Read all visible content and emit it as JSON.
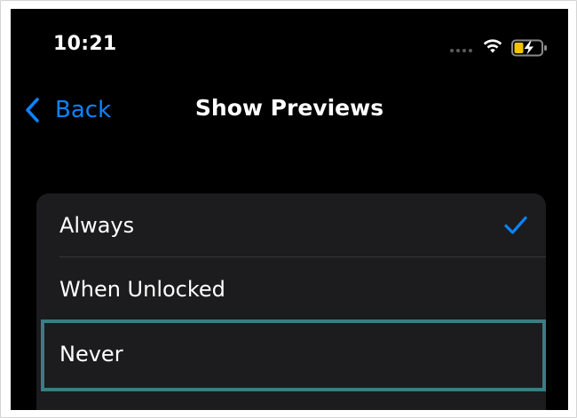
{
  "status_bar": {
    "time": "10:21",
    "signal_icon": "cellular-signal-dots",
    "wifi_icon": "wifi-icon",
    "battery_icon": "battery-charging-icon",
    "battery_color": "#f5c400"
  },
  "nav": {
    "back_label": "Back",
    "title": "Show Previews",
    "accent_color": "#0a84ff"
  },
  "options": [
    {
      "label": "Always",
      "selected": true
    },
    {
      "label": "When Unlocked",
      "selected": false
    },
    {
      "label": "Never",
      "selected": false,
      "highlighted": true
    }
  ],
  "highlight_color": "#3c7c82"
}
